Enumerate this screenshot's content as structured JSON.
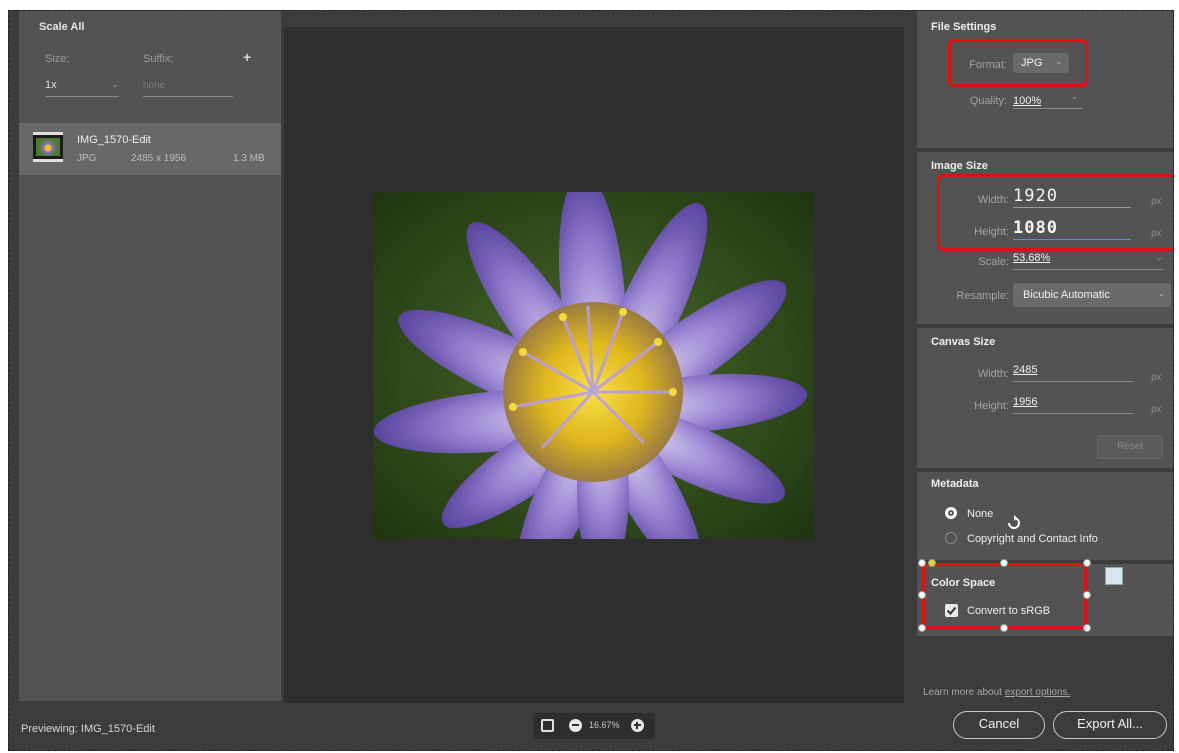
{
  "left_panel": {
    "title": "Scale All",
    "size_label": "Size:",
    "suffix_label": "Suffix:",
    "add_symbol": "+",
    "size_value": "1x",
    "suffix_placeholder": "none",
    "file": {
      "name": "IMG_1570-Edit",
      "format": "JPG",
      "dimensions": "2485 x 1956",
      "filesize": "1.3 MB"
    }
  },
  "file_settings": {
    "title": "File Settings",
    "format_label": "Format:",
    "format_value": "JPG",
    "quality_label": "Quality:",
    "quality_value": "100%"
  },
  "image_size": {
    "title": "Image Size",
    "width_label": "Width:",
    "width_value": "1920",
    "height_label": "Height:",
    "height_value": "1080",
    "unit": "px",
    "scale_label": "Scale:",
    "scale_value": "53.68%",
    "resample_label": "Resample:",
    "resample_value": "Bicubic Automatic"
  },
  "canvas_size": {
    "title": "Canvas Size",
    "width_label": "Width:",
    "width_value": "2485",
    "height_label": "Height:",
    "height_value": "1956",
    "unit": "px",
    "reset_label": "Reset"
  },
  "metadata": {
    "title": "Metadata",
    "option_none": "None",
    "option_copyright": "Copyright and Contact Info"
  },
  "color_space": {
    "title": "Color Space",
    "convert_label": "Convert to sRGB",
    "convert_checked": true
  },
  "footer": {
    "previewing": "Previewing: IMG_1570-Edit",
    "zoom": "16.67%",
    "learn_more_prefix": "Learn more about ",
    "learn_more_link": "export options.",
    "cancel": "Cancel",
    "export": "Export All..."
  },
  "colors": {
    "highlight": "#e01010",
    "panel": "#535353",
    "preview_bg": "#2f2f2f"
  }
}
